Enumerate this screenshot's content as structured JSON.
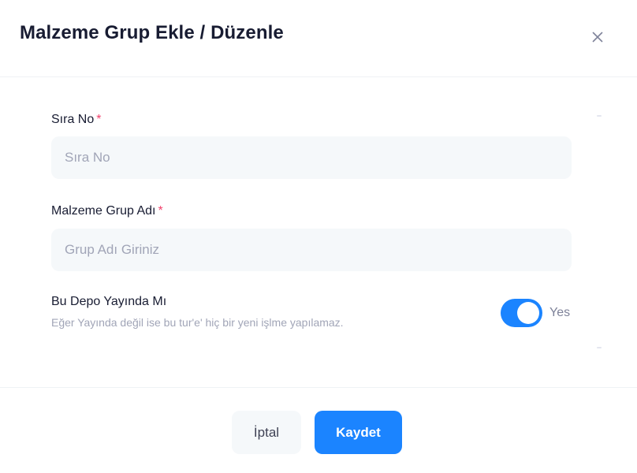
{
  "modal": {
    "title": "Malzeme Grup Ekle / Düzenle",
    "close_icon": "close-icon"
  },
  "form": {
    "sira_no": {
      "label": "Sıra No",
      "required_mark": "*",
      "placeholder": "Sıra No",
      "value": ""
    },
    "grup_adi": {
      "label": "Malzeme Grup Adı",
      "required_mark": "*",
      "placeholder": "Grup Adı Giriniz",
      "value": ""
    },
    "yayinda": {
      "title": "Bu Depo Yayında Mı",
      "description": "Eğer Yayında değil ise bu tur'e' hiç bir yeni işlme yapılamaz.",
      "checked": true,
      "state_label": "Yes"
    }
  },
  "footer": {
    "cancel_label": "İptal",
    "save_label": "Kaydet"
  },
  "colors": {
    "accent": "#1b84ff",
    "required": "#f1416c",
    "input_bg": "#f5f8fa"
  }
}
